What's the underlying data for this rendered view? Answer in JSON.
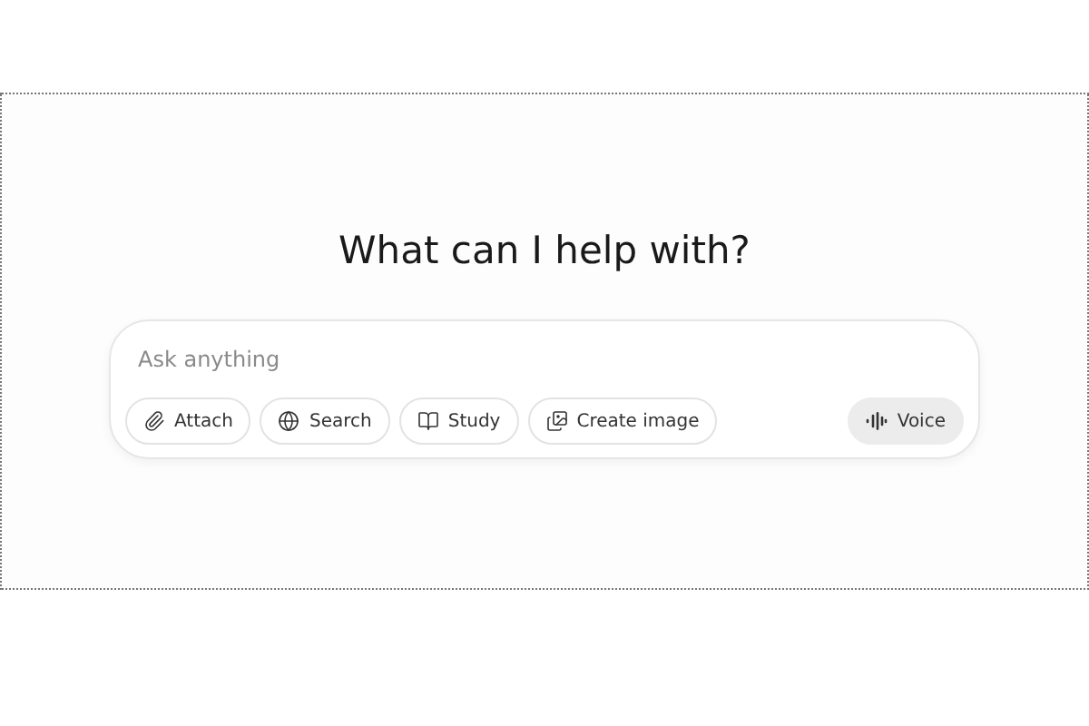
{
  "heading": "What can I help with?",
  "composer": {
    "placeholder": "Ask anything",
    "tools": [
      {
        "kind": "attach",
        "label": "Attach"
      },
      {
        "kind": "search",
        "label": "Search"
      },
      {
        "kind": "study",
        "label": "Study"
      },
      {
        "kind": "image",
        "label": "Create image"
      }
    ],
    "voice": {
      "label": "Voice"
    }
  }
}
